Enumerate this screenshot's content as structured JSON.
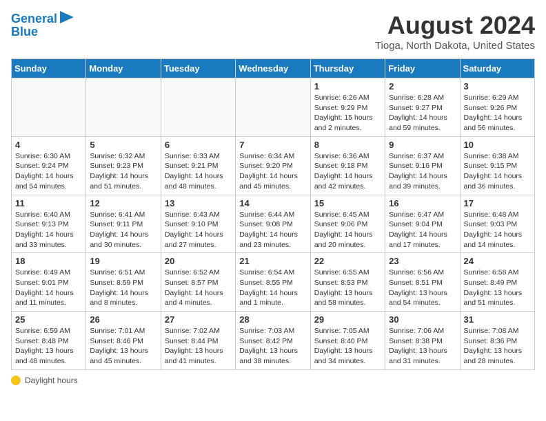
{
  "logo": {
    "line1": "General",
    "line2": "Blue"
  },
  "title": "August 2024",
  "subtitle": "Tioga, North Dakota, United States",
  "days_of_week": [
    "Sunday",
    "Monday",
    "Tuesday",
    "Wednesday",
    "Thursday",
    "Friday",
    "Saturday"
  ],
  "weeks": [
    [
      {
        "num": "",
        "info": ""
      },
      {
        "num": "",
        "info": ""
      },
      {
        "num": "",
        "info": ""
      },
      {
        "num": "",
        "info": ""
      },
      {
        "num": "1",
        "info": "Sunrise: 6:26 AM\nSunset: 9:29 PM\nDaylight: 15 hours and 2 minutes."
      },
      {
        "num": "2",
        "info": "Sunrise: 6:28 AM\nSunset: 9:27 PM\nDaylight: 14 hours and 59 minutes."
      },
      {
        "num": "3",
        "info": "Sunrise: 6:29 AM\nSunset: 9:26 PM\nDaylight: 14 hours and 56 minutes."
      }
    ],
    [
      {
        "num": "4",
        "info": "Sunrise: 6:30 AM\nSunset: 9:24 PM\nDaylight: 14 hours and 54 minutes."
      },
      {
        "num": "5",
        "info": "Sunrise: 6:32 AM\nSunset: 9:23 PM\nDaylight: 14 hours and 51 minutes."
      },
      {
        "num": "6",
        "info": "Sunrise: 6:33 AM\nSunset: 9:21 PM\nDaylight: 14 hours and 48 minutes."
      },
      {
        "num": "7",
        "info": "Sunrise: 6:34 AM\nSunset: 9:20 PM\nDaylight: 14 hours and 45 minutes."
      },
      {
        "num": "8",
        "info": "Sunrise: 6:36 AM\nSunset: 9:18 PM\nDaylight: 14 hours and 42 minutes."
      },
      {
        "num": "9",
        "info": "Sunrise: 6:37 AM\nSunset: 9:16 PM\nDaylight: 14 hours and 39 minutes."
      },
      {
        "num": "10",
        "info": "Sunrise: 6:38 AM\nSunset: 9:15 PM\nDaylight: 14 hours and 36 minutes."
      }
    ],
    [
      {
        "num": "11",
        "info": "Sunrise: 6:40 AM\nSunset: 9:13 PM\nDaylight: 14 hours and 33 minutes."
      },
      {
        "num": "12",
        "info": "Sunrise: 6:41 AM\nSunset: 9:11 PM\nDaylight: 14 hours and 30 minutes."
      },
      {
        "num": "13",
        "info": "Sunrise: 6:43 AM\nSunset: 9:10 PM\nDaylight: 14 hours and 27 minutes."
      },
      {
        "num": "14",
        "info": "Sunrise: 6:44 AM\nSunset: 9:08 PM\nDaylight: 14 hours and 23 minutes."
      },
      {
        "num": "15",
        "info": "Sunrise: 6:45 AM\nSunset: 9:06 PM\nDaylight: 14 hours and 20 minutes."
      },
      {
        "num": "16",
        "info": "Sunrise: 6:47 AM\nSunset: 9:04 PM\nDaylight: 14 hours and 17 minutes."
      },
      {
        "num": "17",
        "info": "Sunrise: 6:48 AM\nSunset: 9:03 PM\nDaylight: 14 hours and 14 minutes."
      }
    ],
    [
      {
        "num": "18",
        "info": "Sunrise: 6:49 AM\nSunset: 9:01 PM\nDaylight: 14 hours and 11 minutes."
      },
      {
        "num": "19",
        "info": "Sunrise: 6:51 AM\nSunset: 8:59 PM\nDaylight: 14 hours and 8 minutes."
      },
      {
        "num": "20",
        "info": "Sunrise: 6:52 AM\nSunset: 8:57 PM\nDaylight: 14 hours and 4 minutes."
      },
      {
        "num": "21",
        "info": "Sunrise: 6:54 AM\nSunset: 8:55 PM\nDaylight: 14 hours and 1 minute."
      },
      {
        "num": "22",
        "info": "Sunrise: 6:55 AM\nSunset: 8:53 PM\nDaylight: 13 hours and 58 minutes."
      },
      {
        "num": "23",
        "info": "Sunrise: 6:56 AM\nSunset: 8:51 PM\nDaylight: 13 hours and 54 minutes."
      },
      {
        "num": "24",
        "info": "Sunrise: 6:58 AM\nSunset: 8:49 PM\nDaylight: 13 hours and 51 minutes."
      }
    ],
    [
      {
        "num": "25",
        "info": "Sunrise: 6:59 AM\nSunset: 8:48 PM\nDaylight: 13 hours and 48 minutes."
      },
      {
        "num": "26",
        "info": "Sunrise: 7:01 AM\nSunset: 8:46 PM\nDaylight: 13 hours and 45 minutes."
      },
      {
        "num": "27",
        "info": "Sunrise: 7:02 AM\nSunset: 8:44 PM\nDaylight: 13 hours and 41 minutes."
      },
      {
        "num": "28",
        "info": "Sunrise: 7:03 AM\nSunset: 8:42 PM\nDaylight: 13 hours and 38 minutes."
      },
      {
        "num": "29",
        "info": "Sunrise: 7:05 AM\nSunset: 8:40 PM\nDaylight: 13 hours and 34 minutes."
      },
      {
        "num": "30",
        "info": "Sunrise: 7:06 AM\nSunset: 8:38 PM\nDaylight: 13 hours and 31 minutes."
      },
      {
        "num": "31",
        "info": "Sunrise: 7:08 AM\nSunset: 8:36 PM\nDaylight: 13 hours and 28 minutes."
      }
    ]
  ],
  "footer": {
    "icon": "sun",
    "text": "Daylight hours"
  }
}
